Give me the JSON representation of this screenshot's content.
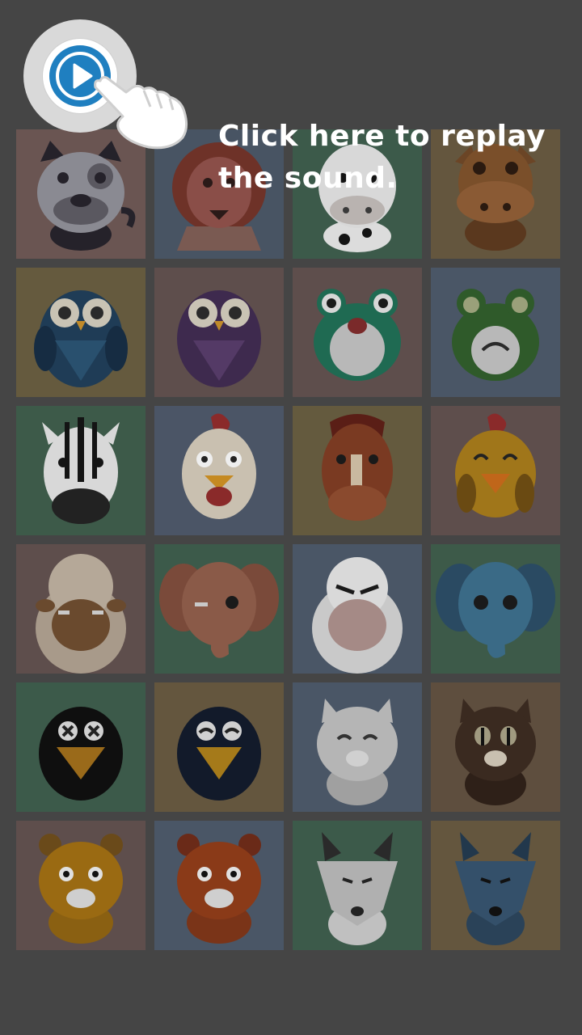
{
  "hint": {
    "line1": "Click here to replay",
    "line2": "the sound."
  },
  "replay_button": {
    "icon": "play-icon",
    "color": "#1f7fc0"
  },
  "tiles": [
    {
      "animal": "dog",
      "bg": "#6a5552"
    },
    {
      "animal": "lion",
      "bg": "#485463"
    },
    {
      "animal": "cow",
      "bg": "#3c5a4a"
    },
    {
      "animal": "horse",
      "bg": "#64563e"
    },
    {
      "animal": "owl",
      "bg": "#655a3e"
    },
    {
      "animal": "owl",
      "bg": "#5e4e4c"
    },
    {
      "animal": "frog",
      "bg": "#5e4e4c"
    },
    {
      "animal": "frog",
      "bg": "#4a5666"
    },
    {
      "animal": "zebra",
      "bg": "#3d5a49"
    },
    {
      "animal": "rooster",
      "bg": "#4b5566"
    },
    {
      "animal": "horse",
      "bg": "#645a3e"
    },
    {
      "animal": "chick",
      "bg": "#5e4e4c"
    },
    {
      "animal": "sheep",
      "bg": "#5e4e4c"
    },
    {
      "animal": "elephant",
      "bg": "#3c5a4a"
    },
    {
      "animal": "sheep",
      "bg": "#4a5666"
    },
    {
      "animal": "elephant",
      "bg": "#3d5a49"
    },
    {
      "animal": "crow",
      "bg": "#3c5a4a"
    },
    {
      "animal": "crow",
      "bg": "#64563e"
    },
    {
      "animal": "cat",
      "bg": "#4a5666"
    },
    {
      "animal": "cat",
      "bg": "#5e4e3e"
    },
    {
      "animal": "tiger",
      "bg": "#5e4e4c"
    },
    {
      "animal": "tiger",
      "bg": "#4a5666"
    },
    {
      "animal": "wolf",
      "bg": "#3c5a4a"
    },
    {
      "animal": "wolf",
      "bg": "#64563e"
    }
  ]
}
